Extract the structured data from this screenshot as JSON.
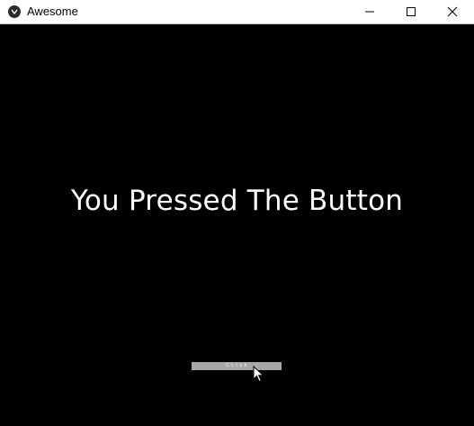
{
  "window": {
    "title": "Awesome",
    "controls": {
      "minimize": "minimize-icon",
      "maximize": "maximize-icon",
      "close": "close-icon"
    }
  },
  "main": {
    "message": "You Pressed The Button",
    "button_label": "Ｃｌｉｃｋ"
  },
  "colors": {
    "background": "#000000",
    "text": "#ffffff",
    "button": "#a8a8a8",
    "titlebar": "#ffffff"
  }
}
